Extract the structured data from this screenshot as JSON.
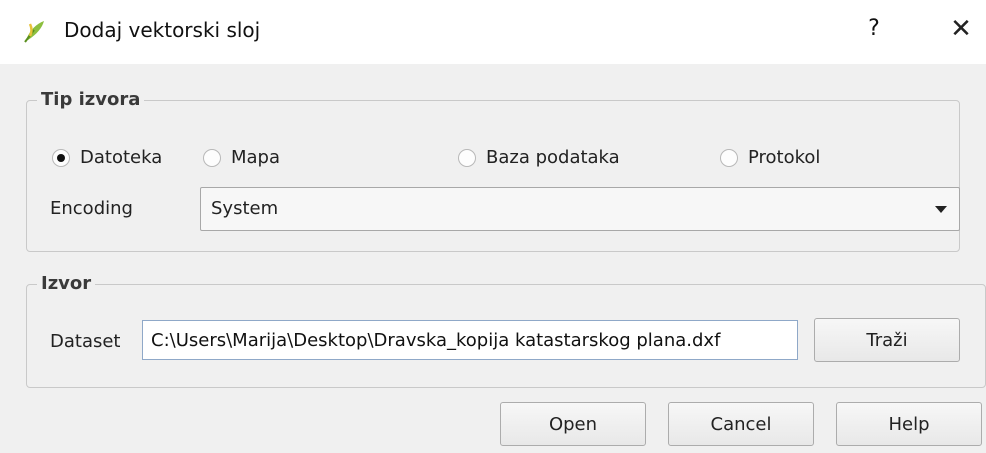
{
  "window": {
    "title": "Dodaj vektorski sloj",
    "help_label": "?",
    "close_label": "✕"
  },
  "source_type": {
    "title": "Tip izvora",
    "options": [
      {
        "label": "Datoteka",
        "checked": true
      },
      {
        "label": "Mapa",
        "checked": false
      },
      {
        "label": "Baza podataka",
        "checked": false
      },
      {
        "label": "Protokol",
        "checked": false
      }
    ],
    "encoding_label": "Encoding",
    "encoding_value": "System"
  },
  "source": {
    "title": "Izvor",
    "dataset_label": "Dataset",
    "dataset_value": "C:\\Users\\Marija\\Desktop\\Dravska_kopija katastarskog plana.dxf",
    "browse_label": "Traži"
  },
  "buttons": {
    "open": "Open",
    "cancel": "Cancel",
    "help": "Help"
  },
  "colors": {
    "background": "#f0f0f0",
    "titlebar": "#ffffff",
    "input_border": "#8fa8c8"
  }
}
